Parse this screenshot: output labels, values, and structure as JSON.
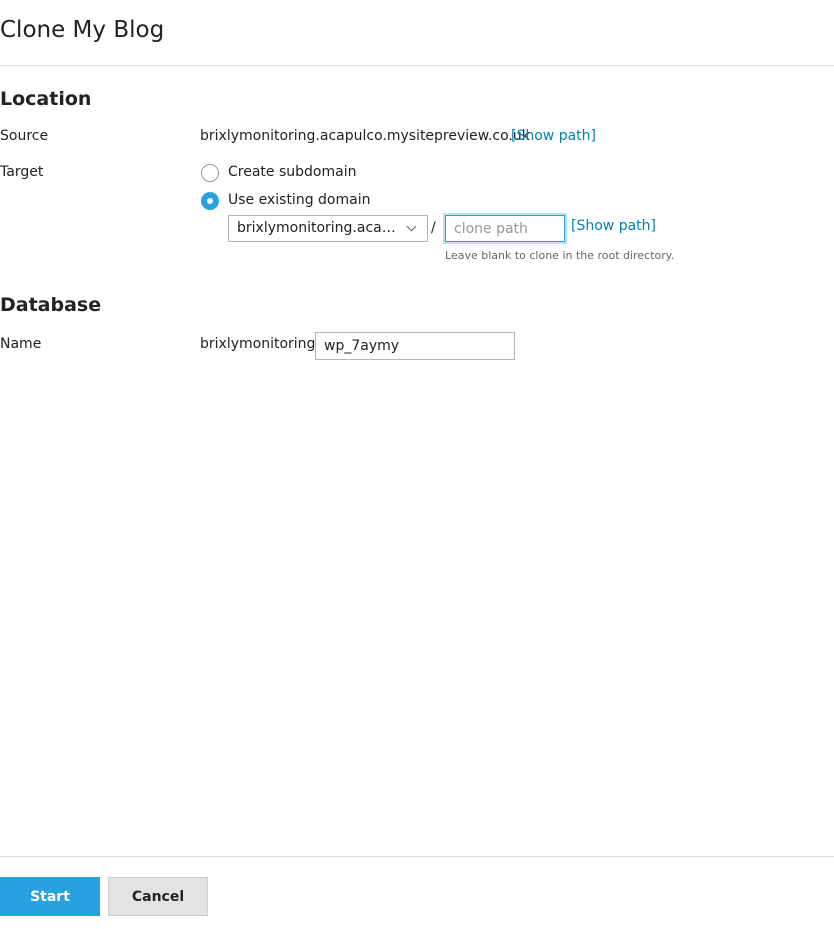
{
  "dialog": {
    "title": "Clone My Blog"
  },
  "location": {
    "heading": "Location",
    "source_label": "Source",
    "source_value": "brixlymonitoring.acapulco.mysitepreview.co.uk",
    "source_show_path": "[Show path]",
    "target_label": "Target",
    "options": [
      {
        "label": "Create subdomain",
        "checked": false
      },
      {
        "label": "Use existing domain",
        "checked": true
      }
    ],
    "domain_select_value": "brixlymonitoring.acap...",
    "separator": "/",
    "clone_path_placeholder": "clone path",
    "clone_path_value": "",
    "target_show_path": "[Show path]",
    "hint": "Leave blank to clone in the root directory."
  },
  "database": {
    "heading": "Database",
    "name_label": "Name",
    "name_prefix": "brixlymonitoring_",
    "name_value": "wp_7aymy"
  },
  "footer": {
    "start_label": "Start",
    "cancel_label": "Cancel"
  },
  "colors": {
    "accent": "#28a1df",
    "link": "#007fb5",
    "divider": "#d9d9d9"
  }
}
